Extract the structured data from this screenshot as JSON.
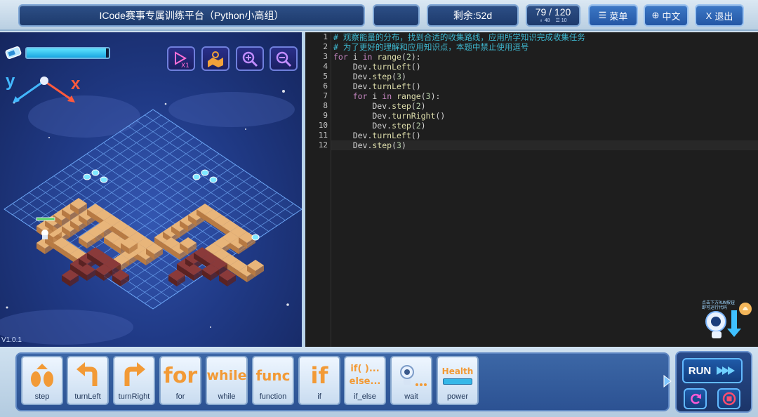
{
  "header": {
    "title": "ICode赛事专属训练平台（Python小高组）",
    "remaining": "剩余:52d",
    "progress_main": "79 / 120",
    "progress_sub_a": "48",
    "progress_sub_b": "10",
    "menu_label": "菜单",
    "lang_label": "中文",
    "exit_label": "退出"
  },
  "game": {
    "axis_y": "y",
    "axis_x": "x",
    "version": "V1.0.1",
    "energy_level": 0.97
  },
  "editor": {
    "line_numbers": [
      "1",
      "2",
      "3",
      "4",
      "5",
      "6",
      "7",
      "8",
      "9",
      "10",
      "11",
      "12"
    ],
    "hint_text": "点击下方RUN按钮 即可运行代码"
  },
  "palette": {
    "blocks": [
      {
        "label": "step",
        "glyph": "step-icon"
      },
      {
        "label": "turnLeft",
        "glyph": "turn-left-icon"
      },
      {
        "label": "turnRight",
        "glyph": "turn-right-icon"
      },
      {
        "label": "for",
        "glyph_text": "for"
      },
      {
        "label": "while",
        "glyph_text": "while"
      },
      {
        "label": "function",
        "glyph_text": "func"
      },
      {
        "label": "if",
        "glyph_text": "if"
      },
      {
        "label": "if_else",
        "glyph_text": "if( )... else..."
      },
      {
        "label": "wait",
        "glyph": "robot-icon"
      },
      {
        "label": "power",
        "glyph_text": "Health"
      }
    ],
    "run_label": "RUN"
  },
  "colors": {
    "accent": "#2457a5",
    "comment": "#3fb8d0",
    "keyword": "#c586c0",
    "number": "#b5cea8"
  }
}
